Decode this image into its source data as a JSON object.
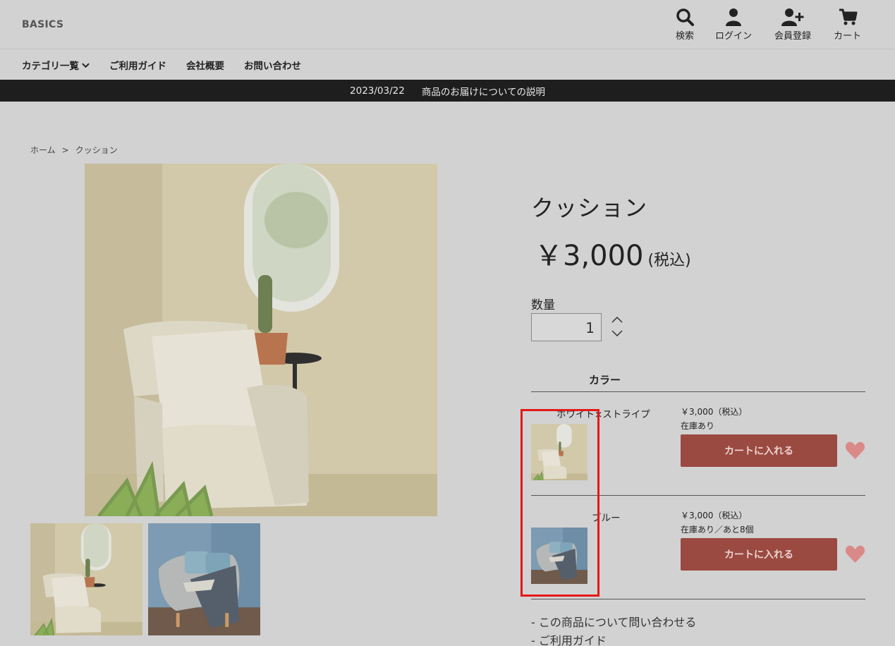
{
  "header": {
    "logo": "BASICS",
    "nav_icons": [
      {
        "label": "検索",
        "icon": "search-icon"
      },
      {
        "label": "ログイン",
        "icon": "user-icon"
      },
      {
        "label": "会員登録",
        "icon": "user-plus-icon"
      },
      {
        "label": "カート",
        "icon": "cart-icon"
      }
    ]
  },
  "menu": {
    "items": [
      "カテゴリ一覧",
      "ご利用ガイド",
      "会社概要",
      "お問い合わせ"
    ]
  },
  "notice": {
    "date": "2023/03/22",
    "text": "商品のお届けについての説明"
  },
  "breadcrumb": {
    "home": "ホーム",
    "separator": ">",
    "current": "クッション"
  },
  "product": {
    "title": "クッション",
    "price": "￥3,000",
    "price_tax": "(税込)",
    "quantity_label": "数量",
    "quantity_value": "1",
    "color_header": "カラー",
    "variants": [
      {
        "name": "ホワイト×ストライプ",
        "price": "￥3,000（税込）",
        "stock": "在庫あり",
        "cart_label": "カートに入れる"
      },
      {
        "name": "ブルー",
        "price": "￥3,000（税込）",
        "stock": "在庫あり／あと8個",
        "cart_label": "カートに入れる"
      }
    ],
    "links": [
      "- この商品について問い合わせる",
      "- ご利用ガイド"
    ]
  },
  "colors": {
    "accent": "#9b4a41",
    "heart": "#d98a88",
    "notice_bg": "#1e1e1e",
    "highlight": "#e41818"
  }
}
